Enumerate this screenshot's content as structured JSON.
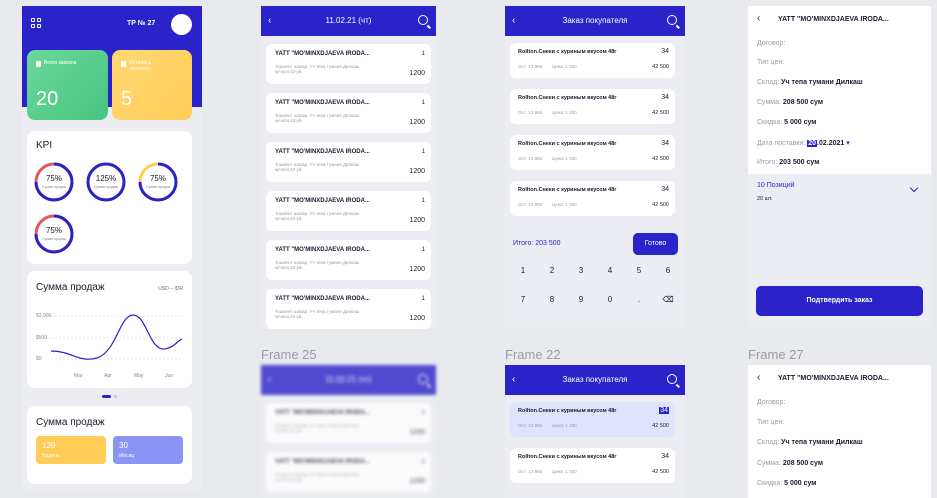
{
  "frame1": {
    "title": "TP № 27",
    "tile1": {
      "label": "Всего заказов",
      "value": "20"
    },
    "tile2": {
      "label": "Осталось посетить",
      "value": "5"
    },
    "kpi": {
      "title": "KPI",
      "gauges": [
        {
          "value": "75%",
          "label": "Сумма продаж",
          "pct": 0.75
        },
        {
          "value": "125%",
          "label": "Сумма продаж",
          "pct": 1.0
        },
        {
          "value": "75%",
          "label": "Сумма продаж",
          "pct": 0.75
        },
        {
          "value": "75%",
          "label": "Сумма продаж",
          "pct": 0.75
        }
      ]
    },
    "sales": {
      "title": "Сумма продаж",
      "currency": "USD",
      "sep": "–",
      "currency2": "IDR",
      "y_ticks": [
        "$3,900",
        "$500",
        "$0"
      ],
      "x_ticks": [
        "Mar",
        "Apr",
        "May",
        "Jun"
      ]
    },
    "sales2": {
      "title": "Сумма продаж",
      "day": {
        "value": "120",
        "label": "Неделя"
      },
      "month": {
        "value": "30",
        "label": "Месяц"
      }
    }
  },
  "frame2": {
    "title": "11.02.21 (чт)",
    "items": [
      {
        "name": "YATT \"MO'MINXDJAEVA IRODA...",
        "qty": "1",
        "address": "Тошкент шахар, Уч тепа тумани Дилкаш кучаси,42-уй.",
        "amount": "1200"
      },
      {
        "name": "YATT \"MO'MINXDJAEVA IRODA...",
        "qty": "1",
        "address": "Тошкент шахар, Уч тепа тумани Дилкаш кучаси,42-уй.",
        "amount": "1200"
      },
      {
        "name": "YATT \"MO'MINXDJAEVA IRODA...",
        "qty": "1",
        "address": "Тошкент шахар, Уч тепа тумани Дилкаш кучаси,42-уй.",
        "amount": "1200"
      },
      {
        "name": "YATT \"MO'MINXDJAEVA IRODA...",
        "qty": "1",
        "address": "Тошкент шахар, Уч тепа тумани Дилкаш кучаси,42-уй.",
        "amount": "1200"
      },
      {
        "name": "YATT \"MO'MINXDJAEVA IRODA...",
        "qty": "1",
        "address": "Тошкент шахар, Уч тепа тумани Дилкаш кучаси,42-уй.",
        "amount": "1200"
      },
      {
        "name": "YATT \"MO'MINXDJAEVA IRODA...",
        "qty": "1",
        "address": "Тошкент шахар, Уч тепа тумани Дилкаш кучаси,42-уй.",
        "amount": "1200"
      }
    ]
  },
  "frame3": {
    "title": "Заказ покупателя",
    "items": [
      {
        "name": "Rollton.Снеки с куриным вкусом 48г",
        "qty": "34",
        "stock": "Ост: 13 865",
        "price": "Цена: 1 250",
        "amount": "42 500"
      },
      {
        "name": "Rollton.Снеки с куриным вкусом 48г",
        "qty": "34",
        "stock": "Ост: 13 865",
        "price": "Цена: 1 250",
        "amount": "42 500"
      },
      {
        "name": "Rollton.Снеки с куриным вкусом 48г",
        "qty": "34",
        "stock": "Ост: 13 865",
        "price": "Цена: 1 250",
        "amount": "42 500"
      },
      {
        "name": "Rollton.Снеки с куриным вкусом 48г",
        "qty": "34",
        "stock": "Ост: 13 865",
        "price": "Цена: 1 250",
        "amount": "42 500"
      }
    ],
    "total": "Итого: 203 500",
    "done": "Готово",
    "keys": [
      "1",
      "2",
      "3",
      "4",
      "5",
      "6",
      "7",
      "8",
      "9",
      "0",
      ".",
      "⌫"
    ]
  },
  "frame4": {
    "back_title": "YATT \"MO'MINXDJAEVA IRODA...",
    "contract": "Договор:",
    "price_type": "Тип цен:",
    "warehouse_label": "Склад:",
    "warehouse": "Уч тепа тумани Дилкаш",
    "sum_label": "Сумма:",
    "sum": "208 500 сум",
    "discount_label": "Скидка:",
    "discount": "5 000 сум",
    "delivery_label": "Дата поставки:",
    "delivery_day": "20",
    "delivery_rest": ".02.2021",
    "total_label": "Итого:",
    "total": "203 500 сум",
    "positions": "10 Позиций",
    "units": "20 шт.",
    "confirm": "Подтвердить заказ"
  },
  "labels": {
    "f25": "Frame 25",
    "f22": "Frame 22",
    "f27": "Frame 27"
  },
  "frame25": {
    "title": "11.02.21 (чт)",
    "items": [
      {
        "name": "YATT \"MO'MINXDJAEVA IRODA...",
        "qty": "1",
        "address": "Тошкент шахар, Уч тепа тумани Дилкаш кучаси,42-уй.",
        "amount": "1200"
      },
      {
        "name": "YATT \"MO'MINXDJAEVA IRODA...",
        "qty": "1",
        "address": "Тошкент шахар, Уч тепа тумани Дилкаш кучаси,42-уй.",
        "amount": "1200"
      }
    ]
  },
  "frame22": {
    "title": "Заказ покупателя",
    "items": [
      {
        "name": "Rollton.Снеки с куриным вкусом 48г",
        "qty": "34",
        "stock": "Ост: 13 865",
        "price": "Цена: 1 250",
        "amount": "42 500"
      },
      {
        "name": "Rollton.Снеки с куриным вкусом 48г",
        "qty": "34",
        "stock": "Ост: 13 865",
        "price": "Цена: 1 250",
        "amount": "42 500"
      }
    ]
  },
  "frame27": {
    "back_title": "YATT \"MO'MINXDJAEVA IRODA...",
    "contract": "Договор:",
    "price_type": "Тип цен:",
    "warehouse_label": "Склад:",
    "warehouse": "Уч тепа тумани Дилкаш",
    "sum_label": "Сумма:",
    "sum": "208 500 сум",
    "discount_label": "Скидка:",
    "discount": "5 000 сум"
  }
}
